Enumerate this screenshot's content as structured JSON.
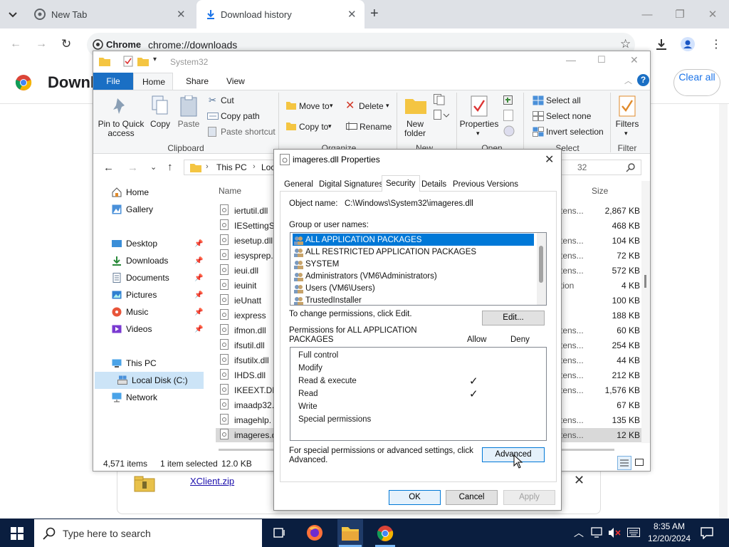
{
  "chrome": {
    "tabs": [
      {
        "title": "New Tab"
      },
      {
        "title": "Download history"
      }
    ],
    "address": "chrome://downloads",
    "chip": "Chrome",
    "page_title": "Downl",
    "clear_all": "Clear all",
    "download_file": "XClient.zip"
  },
  "explorer": {
    "title": "System32",
    "tabs": {
      "file": "File",
      "home": "Home",
      "share": "Share",
      "view": "View"
    },
    "ribbon": {
      "pin": "Pin to Quick access",
      "copy": "Copy",
      "paste": "Paste",
      "cut": "Cut",
      "copy_path": "Copy path",
      "paste_shortcut": "Paste shortcut",
      "clipboard": "Clipboard",
      "move_to": "Move to",
      "copy_to": "Copy to",
      "delete": "Delete",
      "rename": "Rename",
      "organize": "Organize",
      "new_folder": "New folder",
      "new": "New",
      "properties": "Properties",
      "open": "Open",
      "select_all": "Select all",
      "select_none": "Select none",
      "invert_selection": "Invert selection",
      "select": "Select",
      "filters": "Filters",
      "filter": "Filter"
    },
    "path": {
      "this_pc": "This PC",
      "loc": "Loc"
    },
    "search_fragment": "32",
    "nav": {
      "home": "Home",
      "gallery": "Gallery",
      "desktop": "Desktop",
      "downloads": "Downloads",
      "documents": "Documents",
      "pictures": "Pictures",
      "music": "Music",
      "videos": "Videos",
      "this_pc": "This PC",
      "local_disk": "Local Disk (C:)",
      "network": "Network"
    },
    "columns": {
      "name": "Name",
      "size": "Size"
    },
    "files": [
      {
        "name": "iertutil.dll",
        "type": "tens...",
        "size": "2,867 KB"
      },
      {
        "name": "IESettingSy",
        "type": "",
        "size": "468 KB"
      },
      {
        "name": "iesetup.dll",
        "type": "tens...",
        "size": "104 KB"
      },
      {
        "name": "iesysprep.c",
        "type": "tens...",
        "size": "72 KB"
      },
      {
        "name": "ieui.dll",
        "type": "tens...",
        "size": "572 KB"
      },
      {
        "name": "ieuinit",
        "type": "tion",
        "size": "4 KB"
      },
      {
        "name": "ieUnatt",
        "type": "",
        "size": "100 KB"
      },
      {
        "name": "iexpress",
        "type": "",
        "size": "188 KB"
      },
      {
        "name": "ifmon.dll",
        "type": "tens...",
        "size": "60 KB"
      },
      {
        "name": "ifsutil.dll",
        "type": "tens...",
        "size": "254 KB"
      },
      {
        "name": "ifsutilx.dll",
        "type": "tens...",
        "size": "44 KB"
      },
      {
        "name": "IHDS.dll",
        "type": "tens...",
        "size": "212 KB"
      },
      {
        "name": "IKEEXT.DLL",
        "type": "tens...",
        "size": "1,576 KB"
      },
      {
        "name": "imaadp32.",
        "type": "",
        "size": "67 KB"
      },
      {
        "name": "imagehlp.",
        "type": "tens...",
        "size": "135 KB"
      },
      {
        "name": "imageres.d",
        "type": "tens...",
        "size": "12 KB"
      }
    ],
    "status": {
      "items": "4,571 items",
      "selected": "1 item selected",
      "size": "12.0 KB"
    }
  },
  "props": {
    "title": "imageres.dll Properties",
    "tabs": [
      "General",
      "Digital Signatures",
      "Security",
      "Details",
      "Previous Versions"
    ],
    "object_label": "Object name:",
    "object_value": "C:\\Windows\\System32\\imageres.dll",
    "group_label": "Group or user names:",
    "groups": [
      "ALL APPLICATION PACKAGES",
      "ALL RESTRICTED APPLICATION PACKAGES",
      "SYSTEM",
      "Administrators (VM6\\Administrators)",
      "Users (VM6\\Users)",
      "TrustedInstaller"
    ],
    "change_text": "To change permissions, click Edit.",
    "edit": "Edit...",
    "perm_label_1": "Permissions for ALL APPLICATION",
    "perm_label_2": "PACKAGES",
    "allow": "Allow",
    "deny": "Deny",
    "permissions": [
      {
        "name": "Full control",
        "allow": false
      },
      {
        "name": "Modify",
        "allow": false
      },
      {
        "name": "Read & execute",
        "allow": true
      },
      {
        "name": "Read",
        "allow": true
      },
      {
        "name": "Write",
        "allow": false
      },
      {
        "name": "Special permissions",
        "allow": false
      }
    ],
    "check_glyph": "✓",
    "special_1": "For special permissions or advanced settings, click",
    "special_2": "Advanced.",
    "advanced": "Advanced",
    "ok": "OK",
    "cancel": "Cancel",
    "apply": "Apply"
  },
  "taskbar": {
    "search_placeholder": "Type here to search",
    "time": "8:35 AM",
    "date": "12/20/2024"
  },
  "colors": {
    "accent": "#0078d7",
    "file_tab": "#1a6fc4",
    "taskbar": "#0a1e3f"
  }
}
